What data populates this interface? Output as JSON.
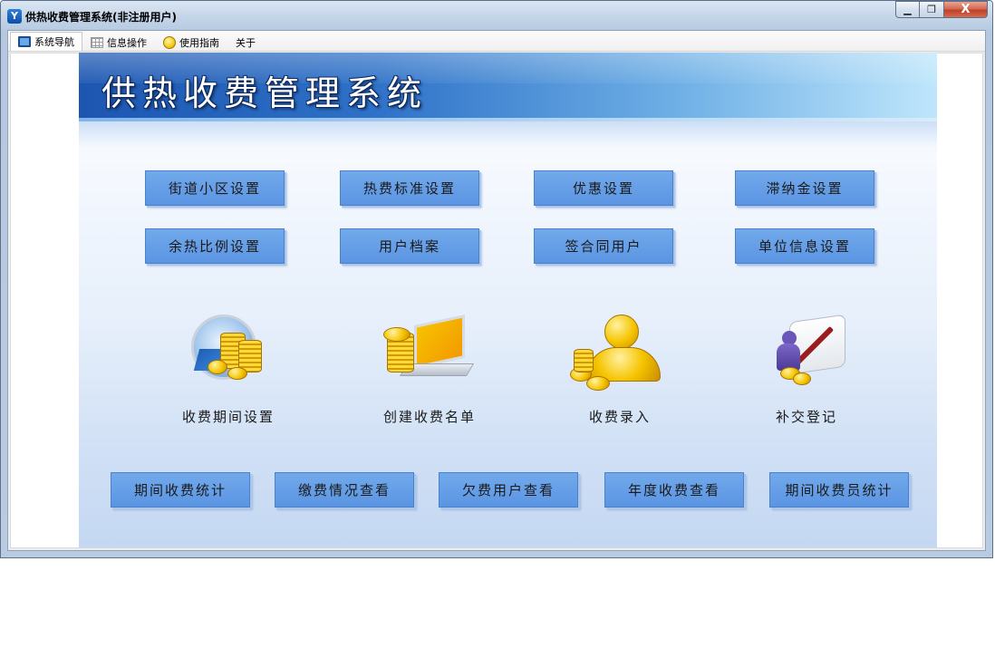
{
  "window": {
    "title": "供热收费管理系统(非注册用户)",
    "app_icon_glyph": "Y",
    "caption": {
      "minimize": "▁",
      "maximize": "❐",
      "close": "X"
    }
  },
  "tabs": [
    {
      "label": "系统导航",
      "icon": "monitor-icon",
      "active": true
    },
    {
      "label": "信息操作",
      "icon": "grid-icon",
      "active": false
    },
    {
      "label": "使用指南",
      "icon": "help-icon",
      "active": false
    },
    {
      "label": "关于",
      "icon": "",
      "active": false
    }
  ],
  "banner": {
    "title": "供热收费管理系统"
  },
  "settings_buttons": [
    "街道小区设置",
    "热费标准设置",
    "优惠设置",
    "滞纳金设置",
    "余热比例设置",
    "用户档案",
    "签合同用户",
    "单位信息设置"
  ],
  "features": [
    {
      "label": "收费期间设置",
      "icon": "clock-coins-icon"
    },
    {
      "label": "创建收费名单",
      "icon": "laptop-coins-icon"
    },
    {
      "label": "收费录入",
      "icon": "person-coins-icon"
    },
    {
      "label": "补交登记",
      "icon": "scroll-pen-icon"
    }
  ],
  "stats_buttons": [
    "期间收费统计",
    "缴费情况查看",
    "欠费用户查看",
    "年度收费查看",
    "期间收费员统计"
  ],
  "colors": {
    "button_fill": "#5b95e2",
    "banner_dark": "#1d56b1",
    "banner_light": "#bfe6fb",
    "close_button": "#c0412a"
  }
}
